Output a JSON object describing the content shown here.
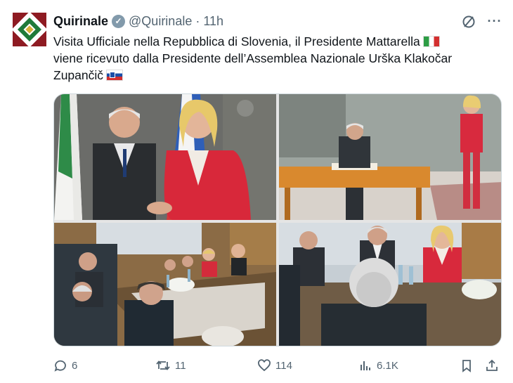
{
  "account": {
    "name": "Quirinale",
    "handle": "@Quirinale",
    "separator": "·",
    "time": "11h"
  },
  "tweet": {
    "text_line1": "Visita Ufficiale nella Repubblica di Slovenia, il Presidente Mattarella",
    "text_line2": "viene ricevuto dalla Presidente dell’Assemblea Nazionale Urška Klakočar",
    "text_line3": "Zupančič",
    "flag_after_line1": "flag-italy",
    "flag_after_line3": "flag-slovenia"
  },
  "media": {
    "photos": [
      "photo-handshake",
      "photo-guestbook-signing",
      "photo-meeting-table",
      "photo-delegation-talks"
    ]
  },
  "metrics": {
    "replies": "6",
    "reposts": "11",
    "likes": "114",
    "views": "6.1K"
  },
  "colors": {
    "text": "#0f1419",
    "secondary": "#536471",
    "avatar_bg": "#8e1b22",
    "verified": "#829aab"
  }
}
